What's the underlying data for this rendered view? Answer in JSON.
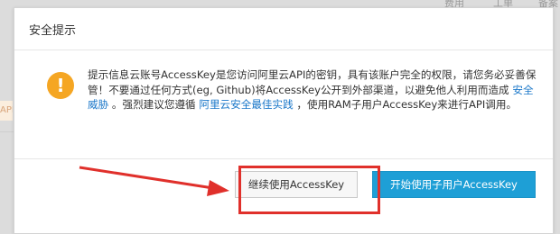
{
  "background": {
    "nav_items": [
      "费用",
      "工单",
      "备案"
    ],
    "left_tag": "API"
  },
  "dialog": {
    "title": "安全提示",
    "icon": "exclamation-icon",
    "message": {
      "part1": "提示信息云账号AccessKey是您访问阿里云API的密钥，具有该账户完全的权限，请您务必妥善保管！不要通过任何方式(eg, Github)将AccessKey公开到外部渠道，以避免他人利用而造成",
      "link1": "安全威胁",
      "part2": "。强烈建议您遵循",
      "link2": "阿里云安全最佳实践",
      "part3": "，使用RAM子用户AccessKey来进行API调用。"
    },
    "buttons": {
      "continue": "继续使用AccessKey",
      "start": "开始使用子用户AccessKey"
    }
  },
  "colors": {
    "warning": "#f5a623",
    "link": "#1a77c9",
    "primary_button": "#1e9fd6",
    "annotation": "#e0302b"
  }
}
